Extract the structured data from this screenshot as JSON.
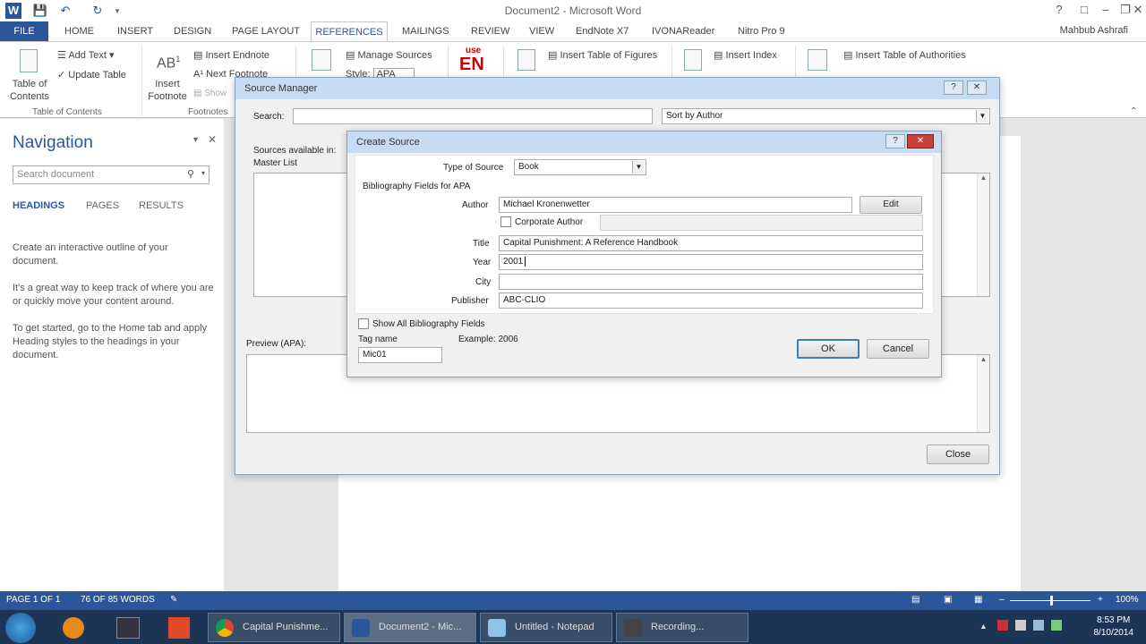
{
  "window": {
    "title": "Document2 - Microsoft Word",
    "user": "Mahbub Ashrafi"
  },
  "tabs": [
    "FILE",
    "HOME",
    "INSERT",
    "DESIGN",
    "PAGE LAYOUT",
    "REFERENCES",
    "MAILINGS",
    "REVIEW",
    "VIEW",
    "EndNote X7",
    "IVONAReader",
    "Nitro Pro 9"
  ],
  "ribbon": {
    "toc_label": "Table of Contents",
    "add_text": "Add Text",
    "update_table": "Update Table",
    "group_toc": "Table of Contents",
    "insert_footnote": "Insert Footnote",
    "insert_endnote": "Insert Endnote",
    "next_footnote": "Next Footnote",
    "show_notes": "Show",
    "group_footnotes": "Footnotes",
    "manage_sources": "Manage Sources",
    "style_label": "Style:",
    "style_value": "APA",
    "endnote_logo": "EN",
    "endnote_use": "use",
    "insert_table_figures": "Insert Table of Figures",
    "insert_index": "Insert Index",
    "insert_toa": "Insert Table of Authorities"
  },
  "navigation": {
    "title": "Navigation",
    "search_placeholder": "Search document",
    "tabs": [
      "HEADINGS",
      "PAGES",
      "RESULTS"
    ],
    "p1": "Create an interactive outline of your document.",
    "p2": "It's a great way to keep track of where you are or quickly move your content around.",
    "p3": "To get started, go to the Home tab and apply Heading styles to the headings in your document."
  },
  "source_manager": {
    "title": "Source Manager",
    "search_label": "Search:",
    "sort_value": "Sort by Author",
    "sources_label": "Sources available in:",
    "master_list": "Master List",
    "preview_label": "Preview (APA):",
    "close_button": "Close"
  },
  "create_source": {
    "title": "Create Source",
    "type_label": "Type of Source",
    "type_value": "Book",
    "fields_header": "Bibliography Fields for APA",
    "author_label": "Author",
    "author_value": "Michael Kronenwetter",
    "edit_button": "Edit",
    "corporate_label": "Corporate Author",
    "title_label": "Title",
    "title_value": "Capital Punishment: A Reference Handbook",
    "year_label": "Year",
    "year_value": "2001",
    "city_label": "City",
    "city_value": "",
    "publisher_label": "Publisher",
    "publisher_value": "ABC-CLIO",
    "show_all_label": "Show All Bibliography Fields",
    "tag_label": "Tag name",
    "tag_value": "Mic01",
    "example_label": "Example: 2006",
    "ok_button": "OK",
    "cancel_button": "Cancel"
  },
  "status": {
    "page": "PAGE 1 OF 1",
    "words": "76 OF 85 WORDS",
    "zoom": "100%"
  },
  "taskbar": {
    "items": [
      "Capital Punishme...",
      "Document2 - Mic...",
      "Untitled - Notepad",
      "Recording..."
    ],
    "time": "8:53 PM",
    "date": "8/10/2014"
  },
  "colors": {
    "accent": "#2b579a",
    "taskbar": "#1c3554"
  }
}
